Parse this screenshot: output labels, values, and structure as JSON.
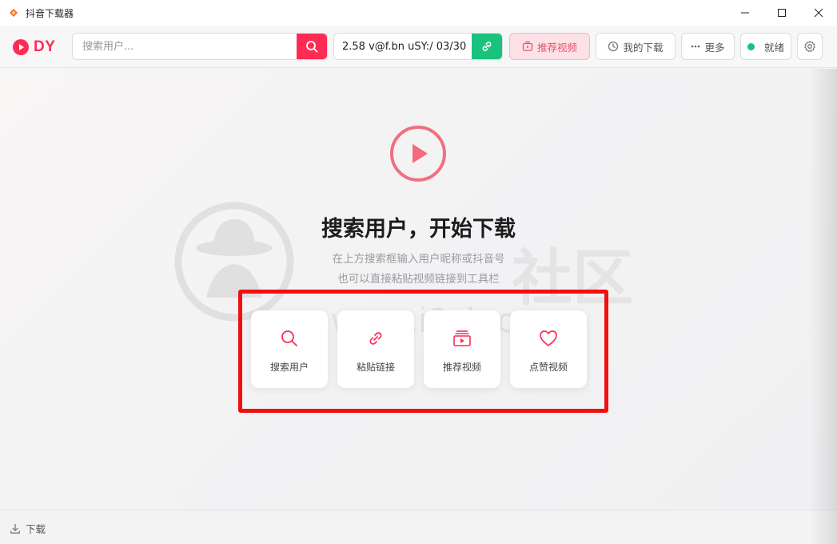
{
  "window": {
    "title": "抖音下载器",
    "controls": [
      "minimize",
      "maximize",
      "close"
    ]
  },
  "toolbar": {
    "logo_text": "DY",
    "search": {
      "placeholder": "搜索用户...",
      "value": ""
    },
    "link_input": {
      "value": "2.58 v@f.bn uSY:/ 03/30"
    },
    "buttons": {
      "recommended": "推荐视频",
      "my_downloads": "我的下载",
      "more": "更多",
      "status": "就绪"
    }
  },
  "main": {
    "title": "搜索用户，开始下载",
    "subtitle_line1": "在上方搜索框输入用户昵称或抖音号",
    "subtitle_line2": "也可以直接粘贴视频链接到工具栏",
    "cards": [
      {
        "label": "搜索用户",
        "icon": "search-icon"
      },
      {
        "label": "粘贴链接",
        "icon": "link-icon"
      },
      {
        "label": "推荐视频",
        "icon": "video-stack-icon"
      },
      {
        "label": "点赞视频",
        "icon": "heart-icon"
      }
    ],
    "watermark_url": "www.i3zh.com",
    "watermark_text": "社区"
  },
  "footer": {
    "download_label": "下载"
  },
  "colors": {
    "accent": "#fe2c55",
    "success": "#19c37d",
    "highlight_border": "#f01010"
  }
}
